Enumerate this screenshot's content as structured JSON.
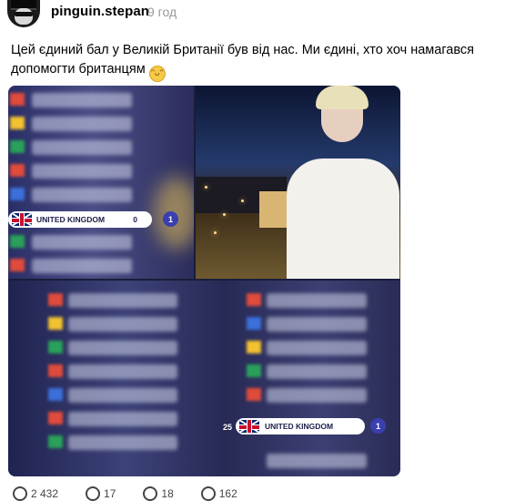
{
  "post": {
    "username": "pinguin.stepan",
    "time": "9 год",
    "text": "Цей єдиний бал у Великій Британії був від нас. Ми єдині, хто хоч намагався допомогти британцям",
    "emoji": "grinning-sweat-emoji"
  },
  "media": {
    "top_bar": {
      "country": "UNITED KINGDOM",
      "score_left": "0",
      "score_right": "1"
    },
    "bottom_bar": {
      "rank": "25",
      "country": "UNITED KINGDOM",
      "score": "1"
    }
  },
  "actions": [
    {
      "icon": "heart-icon",
      "count": "2 432"
    },
    {
      "icon": "comment-icon",
      "count": "17"
    },
    {
      "icon": "repost-icon",
      "count": "18"
    },
    {
      "icon": "share-icon",
      "count": "162"
    }
  ],
  "colors": {
    "bar_blue": "#3a3fb0",
    "text_dark": "#1b1e4a"
  }
}
